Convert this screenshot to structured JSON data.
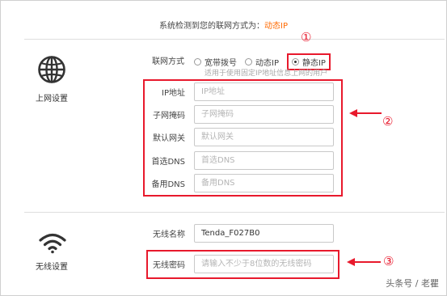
{
  "detect": {
    "prefix": "系统检测到您的联网方式为：",
    "type": "动态IP"
  },
  "internet": {
    "label": "上网设置",
    "mode_label": "联网方式",
    "options": [
      "宽带拨号",
      "动态IP",
      "静态IP"
    ],
    "selected": "静态IP",
    "hint": "适用于使用固定IP地址信息上网的用户",
    "fields": [
      {
        "label": "IP地址",
        "placeholder": "IP地址"
      },
      {
        "label": "子网掩码",
        "placeholder": "子网掩码"
      },
      {
        "label": "默认网关",
        "placeholder": "默认网关"
      },
      {
        "label": "首选DNS",
        "placeholder": "首选DNS"
      },
      {
        "label": "备用DNS",
        "placeholder": "备用DNS"
      }
    ]
  },
  "wireless": {
    "label": "无线设置",
    "name_label": "无线名称",
    "name_value": "Tenda_F027B0",
    "password_label": "无线密码",
    "password_placeholder": "请输入不少于8位数的无线密码"
  },
  "annotations": {
    "one": "①",
    "two": "②",
    "three": "③"
  },
  "watermark": "头条号 / 老瞿",
  "colors": {
    "accent": "#ff6a00",
    "annotation": "#e8192c"
  }
}
